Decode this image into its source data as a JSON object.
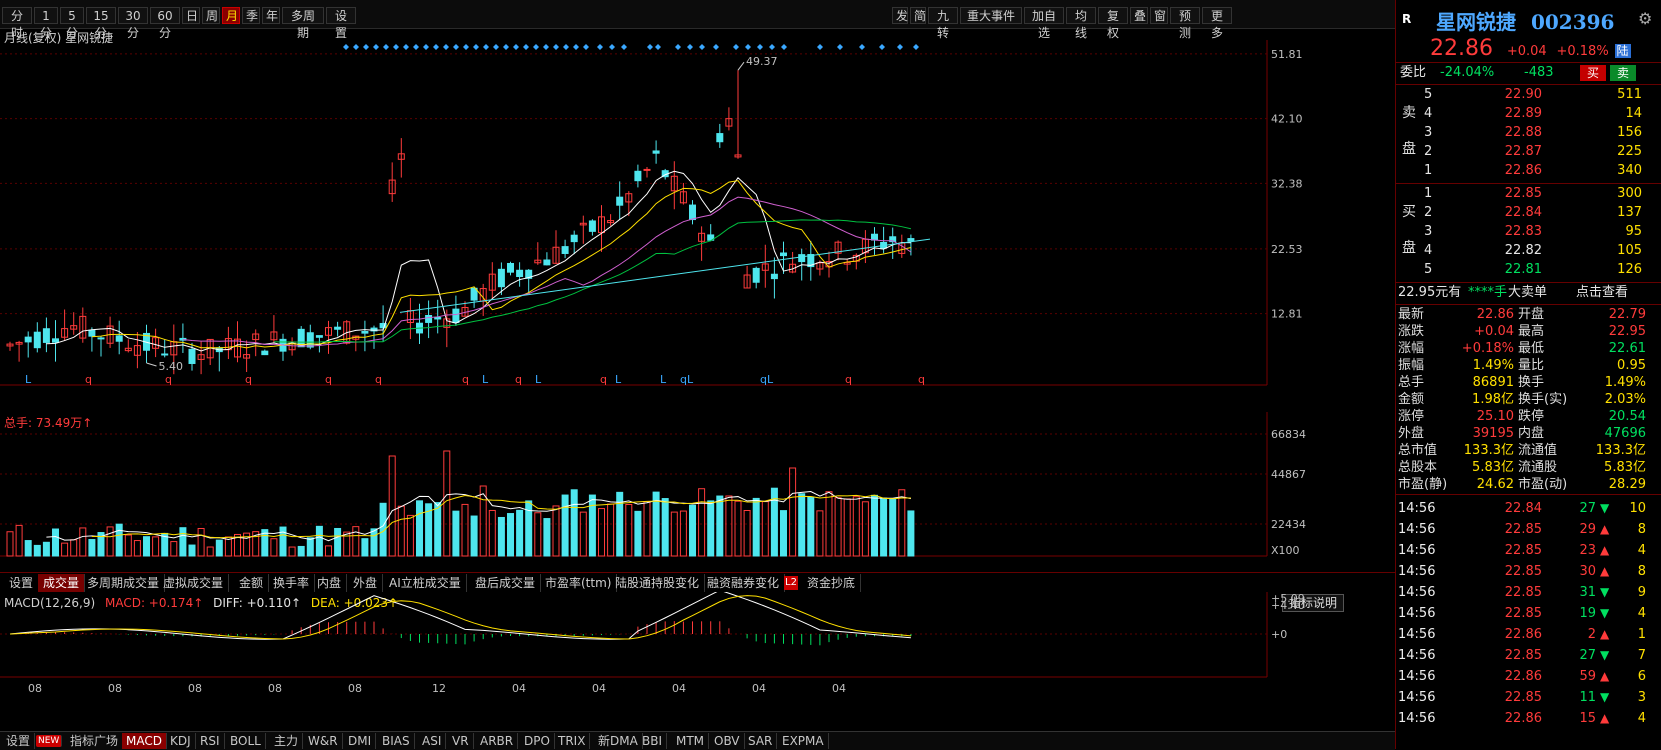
{
  "toolbar": {
    "periods": [
      "分时",
      "1分",
      "5分",
      "15分",
      "30分",
      "60分",
      "日",
      "周",
      "月",
      "季",
      "年",
      "多周期",
      "设置"
    ],
    "active_period": "月",
    "right_buttons": [
      "发",
      "简",
      "九转",
      "重大事件",
      "加自选",
      "均线",
      "复权",
      "叠",
      "窗",
      "预测",
      "更多"
    ]
  },
  "chart_title": "月线(复权)  星网锐捷",
  "price_axis": [
    "51.81",
    "42.10",
    "32.38",
    "22.53",
    "12.81"
  ],
  "annotations": {
    "high": "49.37",
    "low": "5.40"
  },
  "signal_row": [
    "L",
    "q",
    "q",
    "q",
    "q",
    "q",
    "q",
    "L",
    "q",
    "L",
    "q",
    "L",
    "L",
    "qL",
    "qL",
    "q",
    "q"
  ],
  "volume_title": "总手: 73.49万↑",
  "volume_axis": [
    "66834",
    "44867",
    "22434",
    "X100"
  ],
  "indicator_tabs": [
    "设置",
    "成交量",
    "多周期成交量",
    "虚拟成交量",
    "金额",
    "换手率",
    "内盘",
    "外盘",
    "AI立桩成交量",
    "盘后成交量",
    "市盈率(ttm)",
    "陆股通持股变化",
    "融资融券变化",
    "资金抄底"
  ],
  "active_indicator_tab": "成交量",
  "l2_badge": "L2",
  "macd": {
    "title": "MACD(12,26,9)",
    "macd_label": "MACD: +0.174↑",
    "diff_label": "DIFF: +0.110↑",
    "dea_label": "DEA: +0.023↑",
    "axis": [
      "+5.09",
      "+4.40",
      "+0"
    ],
    "help_button": "指标说明"
  },
  "x_axis_labels": [
    "08",
    "08",
    "08",
    "08",
    "08",
    "12",
    "04",
    "04",
    "04",
    "04",
    "04"
  ],
  "bottom_tabs": [
    "设置",
    "NEW",
    "指标广场",
    "MACD",
    "KDJ",
    "RSI",
    "BOLL",
    "主力",
    "W&R",
    "DMI",
    "BIAS",
    "ASI",
    "VR",
    "ARBR",
    "DPO",
    "TRIX",
    "新DMA",
    "BBI",
    "MTM",
    "OBV",
    "SAR",
    "EXPMA"
  ],
  "active_bottom_tab": "MACD",
  "quote": {
    "r_badge": "R",
    "name": "星网锐捷",
    "code": "002396",
    "price": "22.86",
    "change": "+0.04",
    "change_pct": "+0.18%",
    "market_badge": "陆",
    "wei_bi_label": "委比",
    "wei_bi": "-24.04%",
    "wei_cha": "-483",
    "buy_btn": "买",
    "sell_btn": "卖",
    "sell_label": [
      "卖",
      "盘"
    ],
    "buy_label": [
      "买",
      "盘"
    ],
    "asks": [
      {
        "lvl": "5",
        "price": "22.90",
        "vol": "511"
      },
      {
        "lvl": "4",
        "price": "22.89",
        "vol": "14"
      },
      {
        "lvl": "3",
        "price": "22.88",
        "vol": "156"
      },
      {
        "lvl": "2",
        "price": "22.87",
        "vol": "225"
      },
      {
        "lvl": "1",
        "price": "22.86",
        "vol": "340"
      }
    ],
    "bids": [
      {
        "lvl": "1",
        "price": "22.85",
        "vol": "300"
      },
      {
        "lvl": "2",
        "price": "22.84",
        "vol": "137"
      },
      {
        "lvl": "3",
        "price": "22.83",
        "vol": "95"
      },
      {
        "lvl": "4",
        "price": "22.82",
        "vol": "105"
      },
      {
        "lvl": "5",
        "price": "22.81",
        "vol": "126"
      }
    ],
    "big_order": {
      "price": "22.95元有",
      "hand": "****手",
      "label": "大卖单",
      "link": "点击查看"
    },
    "stats": [
      [
        "最新",
        "22.86",
        "开盘",
        "22.79"
      ],
      [
        "涨跌",
        "+0.04",
        "最高",
        "22.95"
      ],
      [
        "涨幅",
        "+0.18%",
        "最低",
        "22.61"
      ],
      [
        "振幅",
        "1.49%",
        "量比",
        "0.95"
      ],
      [
        "总手",
        "86891",
        "换手",
        "1.49%"
      ],
      [
        "金额",
        "1.98亿",
        "换手(实)",
        "2.03%"
      ],
      [
        "涨停",
        "25.10",
        "跌停",
        "20.54"
      ],
      [
        "外盘",
        "39195",
        "内盘",
        "47696"
      ],
      [
        "总市值",
        "133.3亿",
        "流通值",
        "133.3亿"
      ],
      [
        "总股本",
        "5.83亿",
        "流通股",
        "5.83亿"
      ],
      [
        "市盈(静)",
        "24.62",
        "市盈(动)",
        "28.29"
      ]
    ],
    "ticks": [
      {
        "t": "14:56",
        "p": "22.84",
        "v": "27",
        "dir": "down",
        "n": "10"
      },
      {
        "t": "14:56",
        "p": "22.85",
        "v": "29",
        "dir": "up",
        "n": "8"
      },
      {
        "t": "14:56",
        "p": "22.85",
        "v": "23",
        "dir": "up",
        "n": "4"
      },
      {
        "t": "14:56",
        "p": "22.85",
        "v": "30",
        "dir": "up",
        "n": "8"
      },
      {
        "t": "14:56",
        "p": "22.85",
        "v": "31",
        "dir": "down",
        "n": "9"
      },
      {
        "t": "14:56",
        "p": "22.85",
        "v": "19",
        "dir": "down",
        "n": "4"
      },
      {
        "t": "14:56",
        "p": "22.86",
        "v": "2",
        "dir": "up",
        "n": "1"
      },
      {
        "t": "14:56",
        "p": "22.85",
        "v": "27",
        "dir": "down",
        "n": "7"
      },
      {
        "t": "14:56",
        "p": "22.86",
        "v": "59",
        "dir": "up",
        "n": "6"
      },
      {
        "t": "14:56",
        "p": "22.85",
        "v": "11",
        "dir": "down",
        "n": "3"
      },
      {
        "t": "14:56",
        "p": "22.86",
        "v": "15",
        "dir": "up",
        "n": "4"
      }
    ]
  },
  "colors": {
    "up": "#ff3b3b",
    "down": "#00e060",
    "cyan": "#4ee6ee",
    "bg": "#000000",
    "grid": "#5a0000"
  }
}
